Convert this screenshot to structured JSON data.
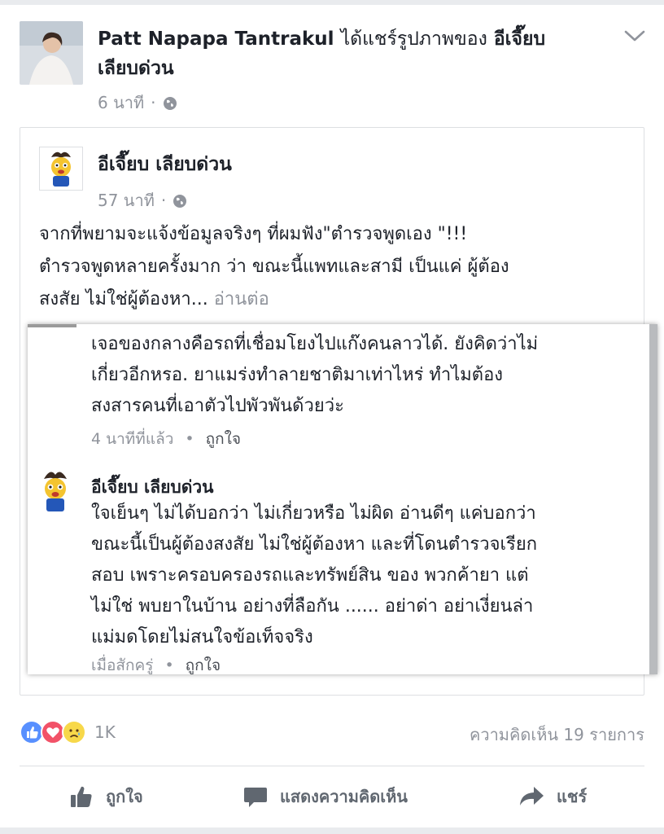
{
  "post": {
    "author": "Patt Napapa Tantrakul",
    "shared_text": "ได้แชร์รูปภาพของ",
    "page_line1": "อีเจี๊ยบ",
    "page_line2": "เลียบด่วน",
    "time": "6 นาที",
    "dot": "·"
  },
  "shared": {
    "page_name": "อีเจี๊ยบ เลียบด่วน",
    "time": "57 นาที",
    "dot": "·",
    "text_line1": "จากที่พยามจะแจ้งข้อมูลจริงๆ ที่ผมฟัง\"ตำรวจพูดเอง \"!!!",
    "text_line2": "ตำรวจพูดหลายครั้งมาก ว่า ขณะนี้แพทและสามี เป็นแค่ ผู้ต้อง",
    "text_line3": "สงสัย ไม่ใช่ผู้ต้องหา...",
    "see_more": "อ่านต่อ"
  },
  "screenshot": {
    "comment1": {
      "line1": "เจอของกลางคือรถที่เชื่อมโยงไปแก๊งคนลาวได้. ยังคิดว่าไม่",
      "line2": "เกี่ยวอีกหรอ. ยาแมร่งทำลายชาติมาเท่าไหร่ ทำไมต้อง",
      "line3": "สงสารคนที่เอาตัวไปพัวพันด้วยว่ะ",
      "time": "4 นาทีที่แล้ว",
      "dot": "•",
      "like": "ถูกใจ"
    },
    "comment2": {
      "name": "อีเจี๊ยบ เลียบด่วน",
      "line1": "ใจเย็นๆ ไม่ได้บอกว่า ไม่เกี่ยวหรือ ไม่ผิด อ่านดีๆ แค่บอกว่า",
      "line2": "ขณะนี้เป็นผู้ต้องสงสัย ไม่ใช่ผู้ต้องหา และที่โดนตำรวจเรียก",
      "line3": "สอบ เพราะครอบครองรถและทรัพย์สิน ของ พวกค้ายา แต่",
      "line4": "ไม่ใช่ พบยาในบ้าน อย่างที่ลือกัน ...... อย่าด่า อย่าเงี่ยนล่า",
      "line5": "แม่มดโดยไม่สนใจข้อเท็จจริง",
      "time": "เมื่อสักครู่",
      "dot": "•",
      "like": "ถูกใจ"
    }
  },
  "reactions": {
    "count": "1K",
    "comments": "ความคิดเห็น 19 รายการ"
  },
  "actions": {
    "like": "ถูกใจ",
    "comment": "แสดงความคิดเห็น",
    "share": "แชร์"
  },
  "colors": {
    "like_blue": "#5890ff",
    "love_red": "#f25268",
    "sad_yellow": "#f7d84a",
    "meta_gray": "#90949c"
  },
  "icons": [
    "globe-icon",
    "chevron-down-icon",
    "like-reaction-icon",
    "love-reaction-icon",
    "sad-reaction-icon",
    "thumbs-up-icon",
    "comment-icon",
    "share-arrow-icon"
  ]
}
